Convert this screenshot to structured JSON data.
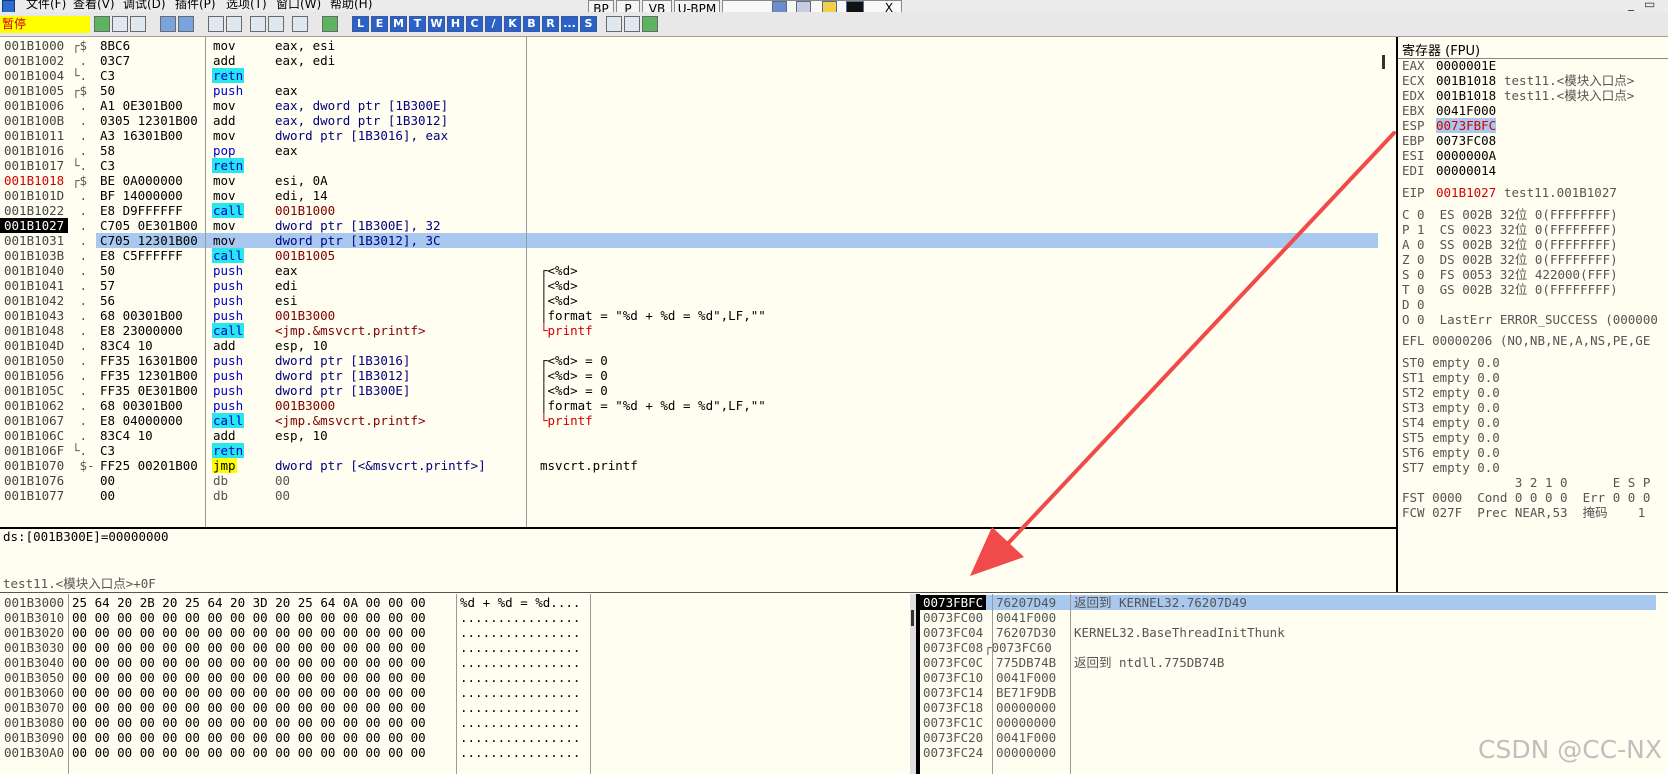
{
  "menu": [
    "文件(F)",
    "查看(V)",
    "调试(D)",
    "插件(P)",
    "选项(T)",
    "窗口(W)",
    "帮助(H)"
  ],
  "top_buttons": [
    "BP",
    "P",
    "VB",
    "U-BPM"
  ],
  "window_controls": {
    "close": "X",
    "min": "_",
    "restore": "▭"
  },
  "status": "暂停",
  "toolbar_letters": [
    "L",
    "E",
    "M",
    "T",
    "W",
    "H",
    "C",
    "/",
    "K",
    "B",
    "R",
    "...",
    "S"
  ],
  "disasm": [
    {
      "addr": "001B1000",
      "br": "┌$",
      "bytes": "8BC6",
      "mn": "mov",
      "op": "eax, esi",
      "cm": ""
    },
    {
      "addr": "001B1002",
      "br": " .",
      "bytes": "03C7",
      "mn": "add",
      "op": "eax, edi",
      "cm": ""
    },
    {
      "addr": "001B1004",
      "br": "└.",
      "bytes": "C3",
      "mn": "retn",
      "op": "",
      "cm": ""
    },
    {
      "addr": "001B1005",
      "br": "┌$",
      "bytes": "50",
      "mn": "push",
      "op": "eax",
      "cm": ""
    },
    {
      "addr": "001B1006",
      "br": " .",
      "bytes": "A1 0E301B00",
      "mn": "mov",
      "op": "eax, dword ptr [1B300E]",
      "cm": ""
    },
    {
      "addr": "001B100B",
      "br": " .",
      "bytes": "0305 12301B00",
      "mn": "add",
      "op": "eax, dword ptr [1B3012]",
      "cm": ""
    },
    {
      "addr": "001B1011",
      "br": " .",
      "bytes": "A3 16301B00",
      "mn": "mov",
      "op": "dword ptr [1B3016], eax",
      "cm": ""
    },
    {
      "addr": "001B1016",
      "br": " .",
      "bytes": "58",
      "mn": "pop",
      "op": "eax",
      "cm": ""
    },
    {
      "addr": "001B1017",
      "br": "└.",
      "bytes": "C3",
      "mn": "retn",
      "op": "",
      "cm": ""
    },
    {
      "addr": "001B1018",
      "br": "┌$",
      "bytes": "BE 0A000000",
      "mn": "mov",
      "op": "esi, 0A",
      "cm": ""
    },
    {
      "addr": "001B101D",
      "br": " .",
      "bytes": "BF 14000000",
      "mn": "mov",
      "op": "edi, 14",
      "cm": ""
    },
    {
      "addr": "001B1022",
      "br": " .",
      "bytes": "E8 D9FFFFFF",
      "mn": "call",
      "op": "001B1000",
      "cm": ""
    },
    {
      "addr": "001B1027",
      "br": " .",
      "bytes": "C705 0E301B00",
      "mn": "mov",
      "op": "dword ptr [1B300E], 32",
      "cm": ""
    },
    {
      "addr": "001B1031",
      "br": " .",
      "bytes": "C705 12301B00",
      "mn": "mov",
      "op": "dword ptr [1B3012], 3C",
      "cm": ""
    },
    {
      "addr": "001B103B",
      "br": " .",
      "bytes": "E8 C5FFFFFF",
      "mn": "call",
      "op": "001B1005",
      "cm": ""
    },
    {
      "addr": "001B1040",
      "br": " .",
      "bytes": "50",
      "mn": "push",
      "op": "eax",
      "cm": "┌<%d>"
    },
    {
      "addr": "001B1041",
      "br": " .",
      "bytes": "57",
      "mn": "push",
      "op": "edi",
      "cm": "│<%d>"
    },
    {
      "addr": "001B1042",
      "br": " .",
      "bytes": "56",
      "mn": "push",
      "op": "esi",
      "cm": "│<%d>"
    },
    {
      "addr": "001B1043",
      "br": " .",
      "bytes": "68 00301B00",
      "mn": "push",
      "op": "001B3000",
      "cm": "│format = \"%d + %d = %d\",LF,\"\""
    },
    {
      "addr": "001B1048",
      "br": " .",
      "bytes": "E8 23000000",
      "mn": "call",
      "op": "<jmp.&msvcrt.printf>",
      "cm": "└printf"
    },
    {
      "addr": "001B104D",
      "br": " .",
      "bytes": "83C4 10",
      "mn": "add",
      "op": "esp, 10",
      "cm": ""
    },
    {
      "addr": "001B1050",
      "br": " .",
      "bytes": "FF35 16301B00",
      "mn": "push",
      "op": "dword ptr [1B3016]",
      "cm": "┌<%d> = 0"
    },
    {
      "addr": "001B1056",
      "br": " .",
      "bytes": "FF35 12301B00",
      "mn": "push",
      "op": "dword ptr [1B3012]",
      "cm": "│<%d> = 0"
    },
    {
      "addr": "001B105C",
      "br": " .",
      "bytes": "FF35 0E301B00",
      "mn": "push",
      "op": "dword ptr [1B300E]",
      "cm": "│<%d> = 0"
    },
    {
      "addr": "001B1062",
      "br": " .",
      "bytes": "68 00301B00",
      "mn": "push",
      "op": "001B3000",
      "cm": "│format = \"%d + %d = %d\",LF,\"\""
    },
    {
      "addr": "001B1067",
      "br": " .",
      "bytes": "E8 04000000",
      "mn": "call",
      "op": "<jmp.&msvcrt.printf>",
      "cm": "└printf"
    },
    {
      "addr": "001B106C",
      "br": " .",
      "bytes": "83C4 10",
      "mn": "add",
      "op": "esp, 10",
      "cm": ""
    },
    {
      "addr": "001B106F",
      "br": "└.",
      "bytes": "C3",
      "mn": "retn",
      "op": "",
      "cm": ""
    },
    {
      "addr": "001B1070",
      "br": " $-",
      "bytes": "FF25 00201B00",
      "mn": "jmp",
      "op": "dword ptr [<&msvcrt.printf>]",
      "cm": "msvcrt.printf"
    },
    {
      "addr": "001B1076",
      "br": "",
      "bytes": "00",
      "mn": "db",
      "op": "00",
      "cm": ""
    },
    {
      "addr": "001B1077",
      "br": "",
      "bytes": "00",
      "mn": "db",
      "op": "00",
      "cm": ""
    }
  ],
  "info": {
    "line1": "ds:[001B300E]=00000000",
    "line2": "test11.<模块入口点>+0F"
  },
  "registers": {
    "title": "寄存器 (FPU)",
    "gp": [
      {
        "name": "EAX",
        "val": "0000001E",
        "note": ""
      },
      {
        "name": "ECX",
        "val": "001B1018",
        "note": "test11.<模块入口点>"
      },
      {
        "name": "EDX",
        "val": "001B1018",
        "note": "test11.<模块入口点>"
      },
      {
        "name": "EBX",
        "val": "0041F000",
        "note": ""
      },
      {
        "name": "ESP",
        "val": "0073FBFC",
        "note": ""
      },
      {
        "name": "EBP",
        "val": "0073FC08",
        "note": ""
      },
      {
        "name": "ESI",
        "val": "0000000A",
        "note": ""
      },
      {
        "name": "EDI",
        "val": "00000014",
        "note": ""
      }
    ],
    "eip": {
      "name": "EIP",
      "val": "001B1027",
      "note": "test11.001B1027"
    },
    "flags": [
      "C 0  ES 002B 32位 0(FFFFFFFF)",
      "P 1  CS 0023 32位 0(FFFFFFFF)",
      "A 0  SS 002B 32位 0(FFFFFFFF)",
      "Z 0  DS 002B 32位 0(FFFFFFFF)",
      "S 0  FS 0053 32位 422000(FFF)",
      "T 0  GS 002B 32位 0(FFFFFFFF)",
      "D 0",
      "O 0  LastErr ERROR_SUCCESS (000000"
    ],
    "efl": "EFL 00000206 (NO,NB,NE,A,NS,PE,GE",
    "st": [
      "ST0 empty 0.0",
      "ST1 empty 0.0",
      "ST2 empty 0.0",
      "ST3 empty 0.0",
      "ST4 empty 0.0",
      "ST5 empty 0.0",
      "ST6 empty 0.0",
      "ST7 empty 0.0"
    ],
    "fpu_hdr": "               3 2 1 0      E S P",
    "fst": "FST 0000  Cond 0 0 0 0  Err 0 0 0",
    "fcw": "FCW 027F  Prec NEAR,53  掩码    1"
  },
  "dump": [
    {
      "addr": "001B3000",
      "hex": "25 64 20 2B 20 25 64 20 3D 20 25 64 0A 00 00 00",
      "ascii": "%d + %d = %d...."
    },
    {
      "addr": "001B3010",
      "hex": "00 00 00 00 00 00 00 00 00 00 00 00 00 00 00 00",
      "ascii": "................"
    },
    {
      "addr": "001B3020",
      "hex": "00 00 00 00 00 00 00 00 00 00 00 00 00 00 00 00",
      "ascii": "................"
    },
    {
      "addr": "001B3030",
      "hex": "00 00 00 00 00 00 00 00 00 00 00 00 00 00 00 00",
      "ascii": "................"
    },
    {
      "addr": "001B3040",
      "hex": "00 00 00 00 00 00 00 00 00 00 00 00 00 00 00 00",
      "ascii": "................"
    },
    {
      "addr": "001B3050",
      "hex": "00 00 00 00 00 00 00 00 00 00 00 00 00 00 00 00",
      "ascii": "................"
    },
    {
      "addr": "001B3060",
      "hex": "00 00 00 00 00 00 00 00 00 00 00 00 00 00 00 00",
      "ascii": "................"
    },
    {
      "addr": "001B3070",
      "hex": "00 00 00 00 00 00 00 00 00 00 00 00 00 00 00 00",
      "ascii": "................"
    },
    {
      "addr": "001B3080",
      "hex": "00 00 00 00 00 00 00 00 00 00 00 00 00 00 00 00",
      "ascii": "................"
    },
    {
      "addr": "001B3090",
      "hex": "00 00 00 00 00 00 00 00 00 00 00 00 00 00 00 00",
      "ascii": "................"
    },
    {
      "addr": "001B30A0",
      "hex": "00 00 00 00 00 00 00 00 00 00 00 00 00 00 00 00",
      "ascii": "................"
    }
  ],
  "stack": [
    {
      "addr": "0073FBFC",
      "val": "76207D49",
      "note": "返回到 KERNEL32.76207D49"
    },
    {
      "addr": "0073FC00",
      "val": "0041F000",
      "note": ""
    },
    {
      "addr": "0073FC04",
      "val": "76207D30",
      "note": "KERNEL32.BaseThreadInitThunk"
    },
    {
      "addr": "0073FC08",
      "val": "┌0073FC60",
      "note": ""
    },
    {
      "addr": "0073FC0C",
      "val": "775DB74B",
      "note": "返回到 ntdll.775DB74B"
    },
    {
      "addr": "0073FC10",
      "val": "0041F000",
      "note": ""
    },
    {
      "addr": "0073FC14",
      "val": "BE71F9DB",
      "note": ""
    },
    {
      "addr": "0073FC18",
      "val": "00000000",
      "note": ""
    },
    {
      "addr": "0073FC1C",
      "val": "00000000",
      "note": ""
    },
    {
      "addr": "0073FC20",
      "val": "0041F000",
      "note": ""
    },
    {
      "addr": "0073FC24",
      "val": "00000000",
      "note": ""
    }
  ],
  "watermark": "CSDN @CC-NX",
  "colors": {
    "call_bg": "#27e6ee",
    "jmp_bg": "#ffff00",
    "highlight_row": "#a9c8ef",
    "arrow": "#f04a4a",
    "pane_bg": "#fffef0"
  }
}
